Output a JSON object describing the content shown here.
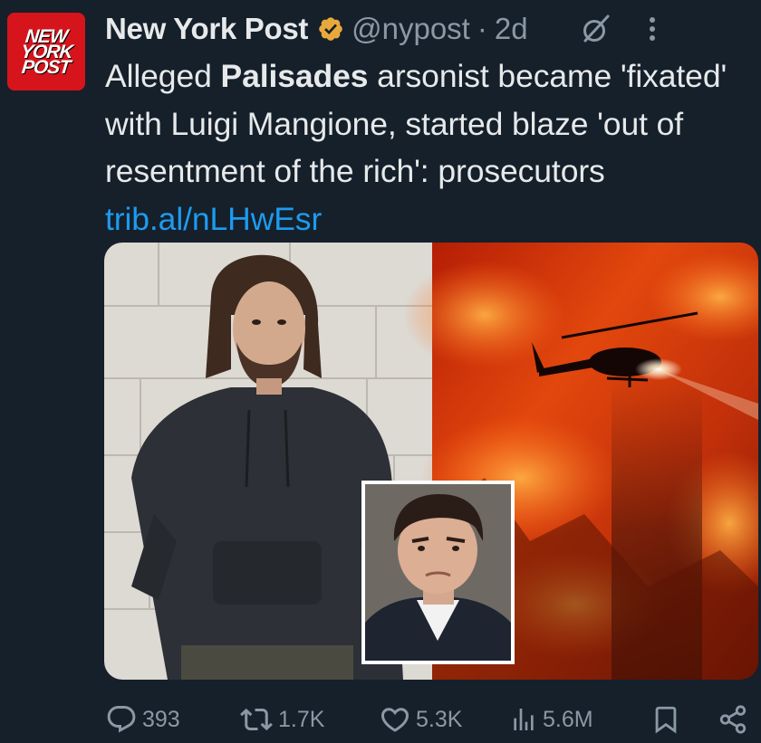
{
  "author": {
    "avatar_text": [
      "NEW",
      "YORK",
      "POST"
    ],
    "display_name": "New York Post",
    "handle": "@nypost",
    "separator": "·",
    "time": "2d",
    "verified_color": "#e8a93b"
  },
  "tweet": {
    "text_part1": "Alleged ",
    "text_bold": "Palisades",
    "text_part2": " arsonist became 'fixated' with Luigi Mangione, started blaze 'out of resentment of the rich': prosecutors ",
    "link": "trib.al/nLHwEsr"
  },
  "actions": {
    "replies": "393",
    "reposts": "1.7K",
    "likes": "5.3K",
    "views": "5.6M"
  },
  "colors": {
    "background": "#15202b",
    "text": "#e7e9ea",
    "muted": "#8b98a5",
    "link": "#1d9bf0",
    "brand_red": "#d6141c"
  },
  "icons": [
    "verified-badge-icon",
    "grok-icon",
    "more-icon",
    "reply-icon",
    "repost-icon",
    "like-icon",
    "views-icon",
    "bookmark-icon",
    "share-icon"
  ]
}
